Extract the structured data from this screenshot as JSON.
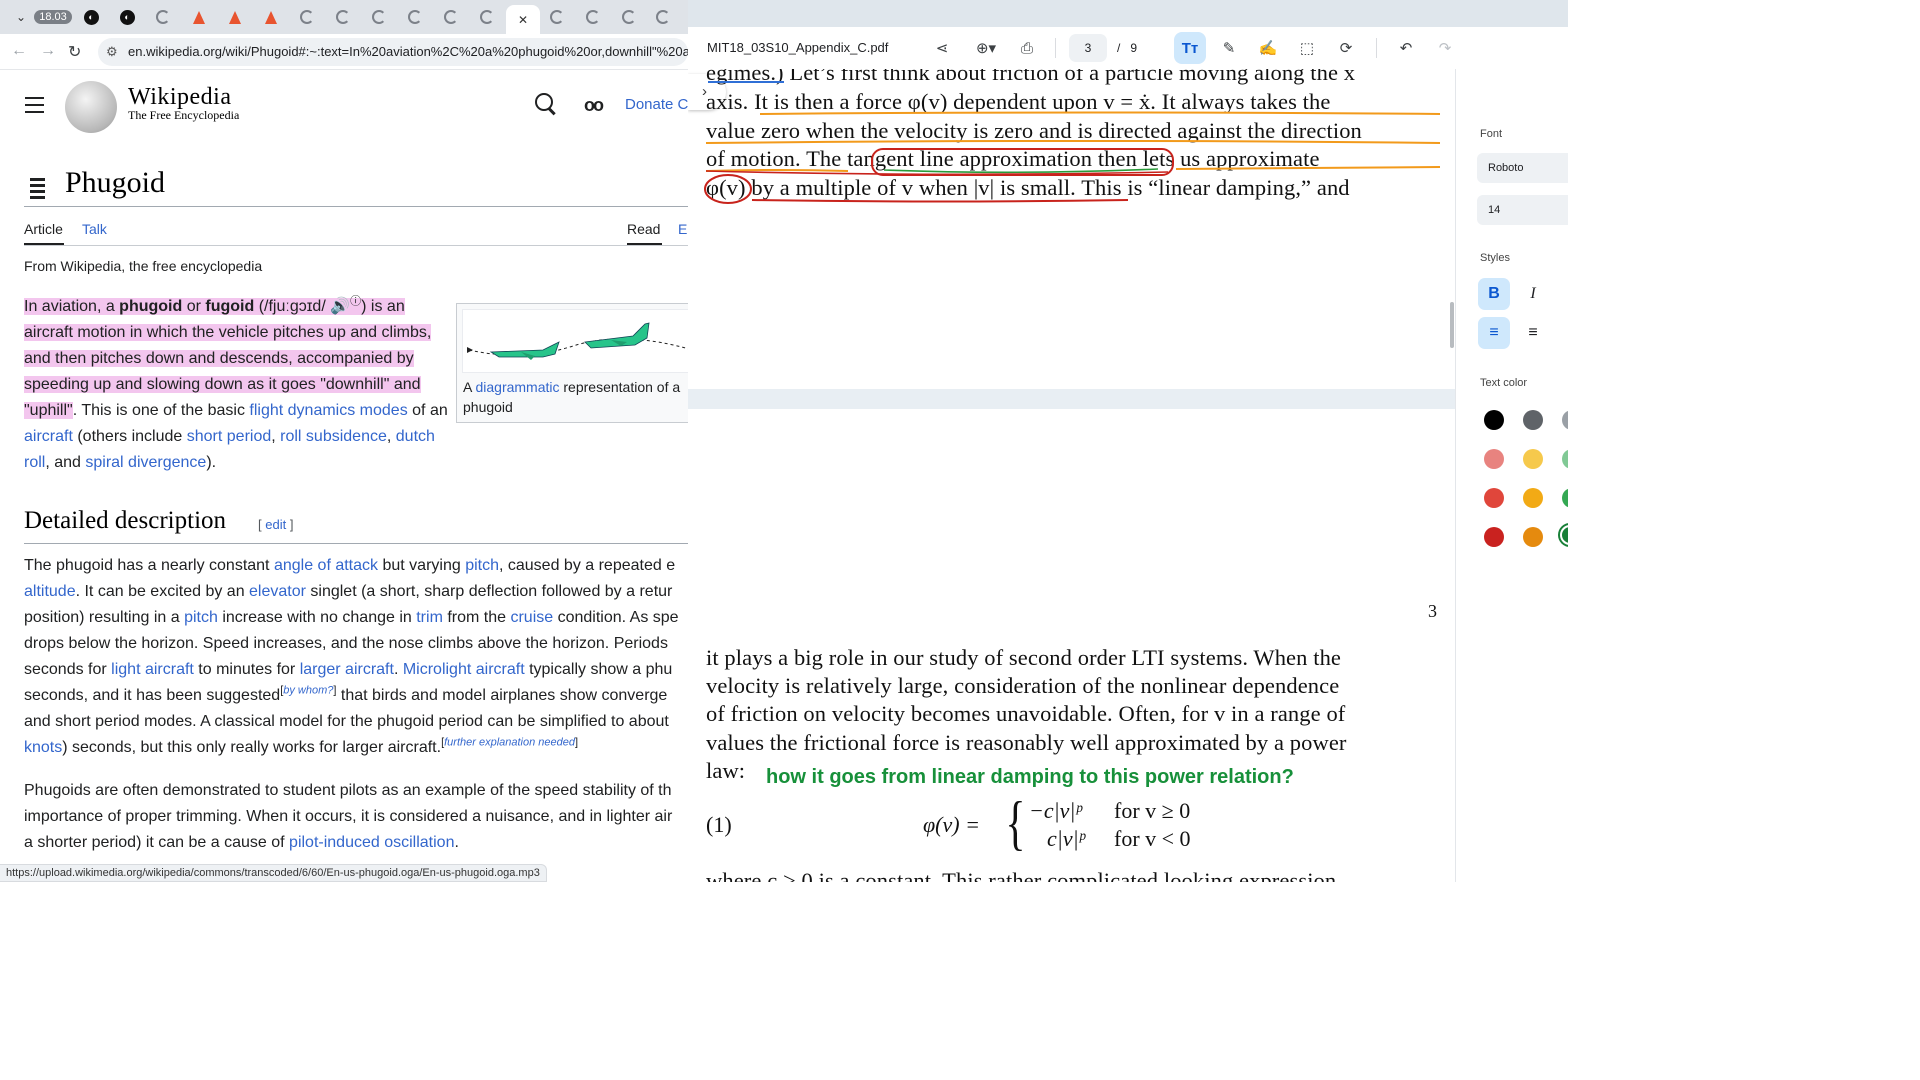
{
  "browser": {
    "clock_badge": "18.03",
    "url": "en.wikipedia.org/wiki/Phugoid#:~:text=In%20aviation%2C%20a%20phugoid%20or,downhill\"%20and%20\"up...",
    "status_url": "https://upload.wikimedia.org/wikipedia/commons/transcoded/6/60/En-us-phugoid.oga/En-us-phugoid.oga.mp3"
  },
  "wiki": {
    "wordmark": "Wikipedia",
    "tagline": "The Free Encyclopedia",
    "donate": "Donate",
    "create_partial": "C",
    "title": "Phugoid",
    "tab_article": "Article",
    "tab_talk": "Talk",
    "tab_read": "Read",
    "tab_edit_partial": "E",
    "from": "From Wikipedia, the free encyclopedia",
    "lead": {
      "t1": "In aviation, a ",
      "b1": "phugoid",
      "t2": " or ",
      "b2": "fugoid",
      "t3": " (/fjuːɡɔɪd/ ",
      "sound": "🔊",
      "info": "ⓘ",
      "t4": ") is an aircraft motion in which the vehicle pitches up and climbs, and then pitches down and descends, accompanied by speeding up and slowing down as it goes \"downhill\" and \"uphill\"",
      "t5": ". This is one of the basic ",
      "l1": "flight dynamics modes",
      "t6": " of an ",
      "l2": "aircraft",
      "t7": " (others include ",
      "l3": "short period",
      "t8": ", ",
      "l4": "roll subsidence",
      "t9": ", ",
      "l5": "dutch roll",
      "t10": ", and ",
      "l6": "spiral divergence",
      "t11": ")."
    },
    "thumb_cap_pre": "A ",
    "thumb_cap_link": "diagrammatic",
    "thumb_cap_post": " representation of a phugoid",
    "h2": "Detailed description",
    "edit": "edit",
    "body1": {
      "t1": "The phugoid has a nearly constant ",
      "l1": "angle of attack",
      "t2": " but varying ",
      "l2": "pitch",
      "t3": ", caused by a repeated e",
      "l3": "altitude",
      "t4": ". It can be excited by an ",
      "l4": "elevator",
      "t5": " singlet (a short, sharp deflection followed by a retur",
      "t6": "position) resulting in a ",
      "l5": "pitch",
      "t7": " increase with no change in ",
      "l6": "trim",
      "t8": " from the ",
      "l7": "cruise",
      "t9": " condition. As spe",
      "t10": "drops below the horizon. Speed increases, and the nose climbs above the horizon. Periods",
      "t11": "seconds for ",
      "l8": "light aircraft",
      "t12": " to minutes for ",
      "l9": "larger aircraft",
      "t13": ". ",
      "l10": "Microlight aircraft",
      "t14": " typically show a phu",
      "t15": "seconds, and it has been suggested",
      "sup1": "by whom?",
      "t16": " that birds and model airplanes show converge",
      "t17": "and short period modes. A classical model for the phugoid period can be simplified to about",
      "l11": "knots",
      "t18": ") seconds, but this only really works for larger aircraft.",
      "sup2": "further explanation needed"
    },
    "body2": {
      "t1": "Phugoids are often demonstrated to student pilots as an example of the speed stability of th",
      "t2": "importance of proper trimming. When it occurs, it is considered a nuisance, and in lighter air",
      "t3": "a shorter period) it can be a cause of ",
      "l1": "pilot-induced oscillation",
      "t4": "."
    }
  },
  "pdf": {
    "filename": "MIT18_03S10_Appendix_C.pdf",
    "page_current": "3",
    "page_total": "9",
    "lines_top": [
      "egimes.) Let’s first think about friction of a particle moving along the x",
      "axis. It is then a force φ(v) dependent upon v = ẋ. It always takes the",
      "value zero when the velocity is zero and is directed against the direction",
      "of motion. The tangent line approximation then lets us approximate",
      "φ(v) by a multiple of v when |v| is small. This is “linear damping,” and"
    ],
    "page_number": "3",
    "lines_bottom": [
      "it plays a big role in our study of second order LTI systems. When the",
      "velocity is relatively large, consideration of the nonlinear dependence",
      "of friction on velocity becomes unavoidable. Often, for v in a range of",
      "values the frictional force is reasonably well approximated by a power",
      "law:"
    ],
    "annotation": "how it goes from linear damping to this power relation?",
    "eq_number": "(1)",
    "eq_lhs": "φ(v) =",
    "eq_case1": "−c|v|ᵖ",
    "eq_cond1": "for v ≥ 0",
    "eq_case2": "c|v|ᵖ",
    "eq_cond2": "for v < 0",
    "partial_line": "where c > 0 is a constant. This rather complicated looking expression"
  },
  "panel": {
    "font_label": "Font",
    "font_value": "Roboto",
    "size_value": "14",
    "styles_label": "Styles",
    "bold": "B",
    "italic": "I",
    "color_label": "Text color"
  },
  "colors": {
    "highlight": "#f3c6ee",
    "link": "#3366cc",
    "annotation_green": "#17903a",
    "swatches": [
      "#000000",
      "#5f6368",
      "#e8837f",
      "#f6c94c",
      "#e0463b",
      "#f2aa15",
      "#c9221f",
      "#e58a0e"
    ]
  }
}
